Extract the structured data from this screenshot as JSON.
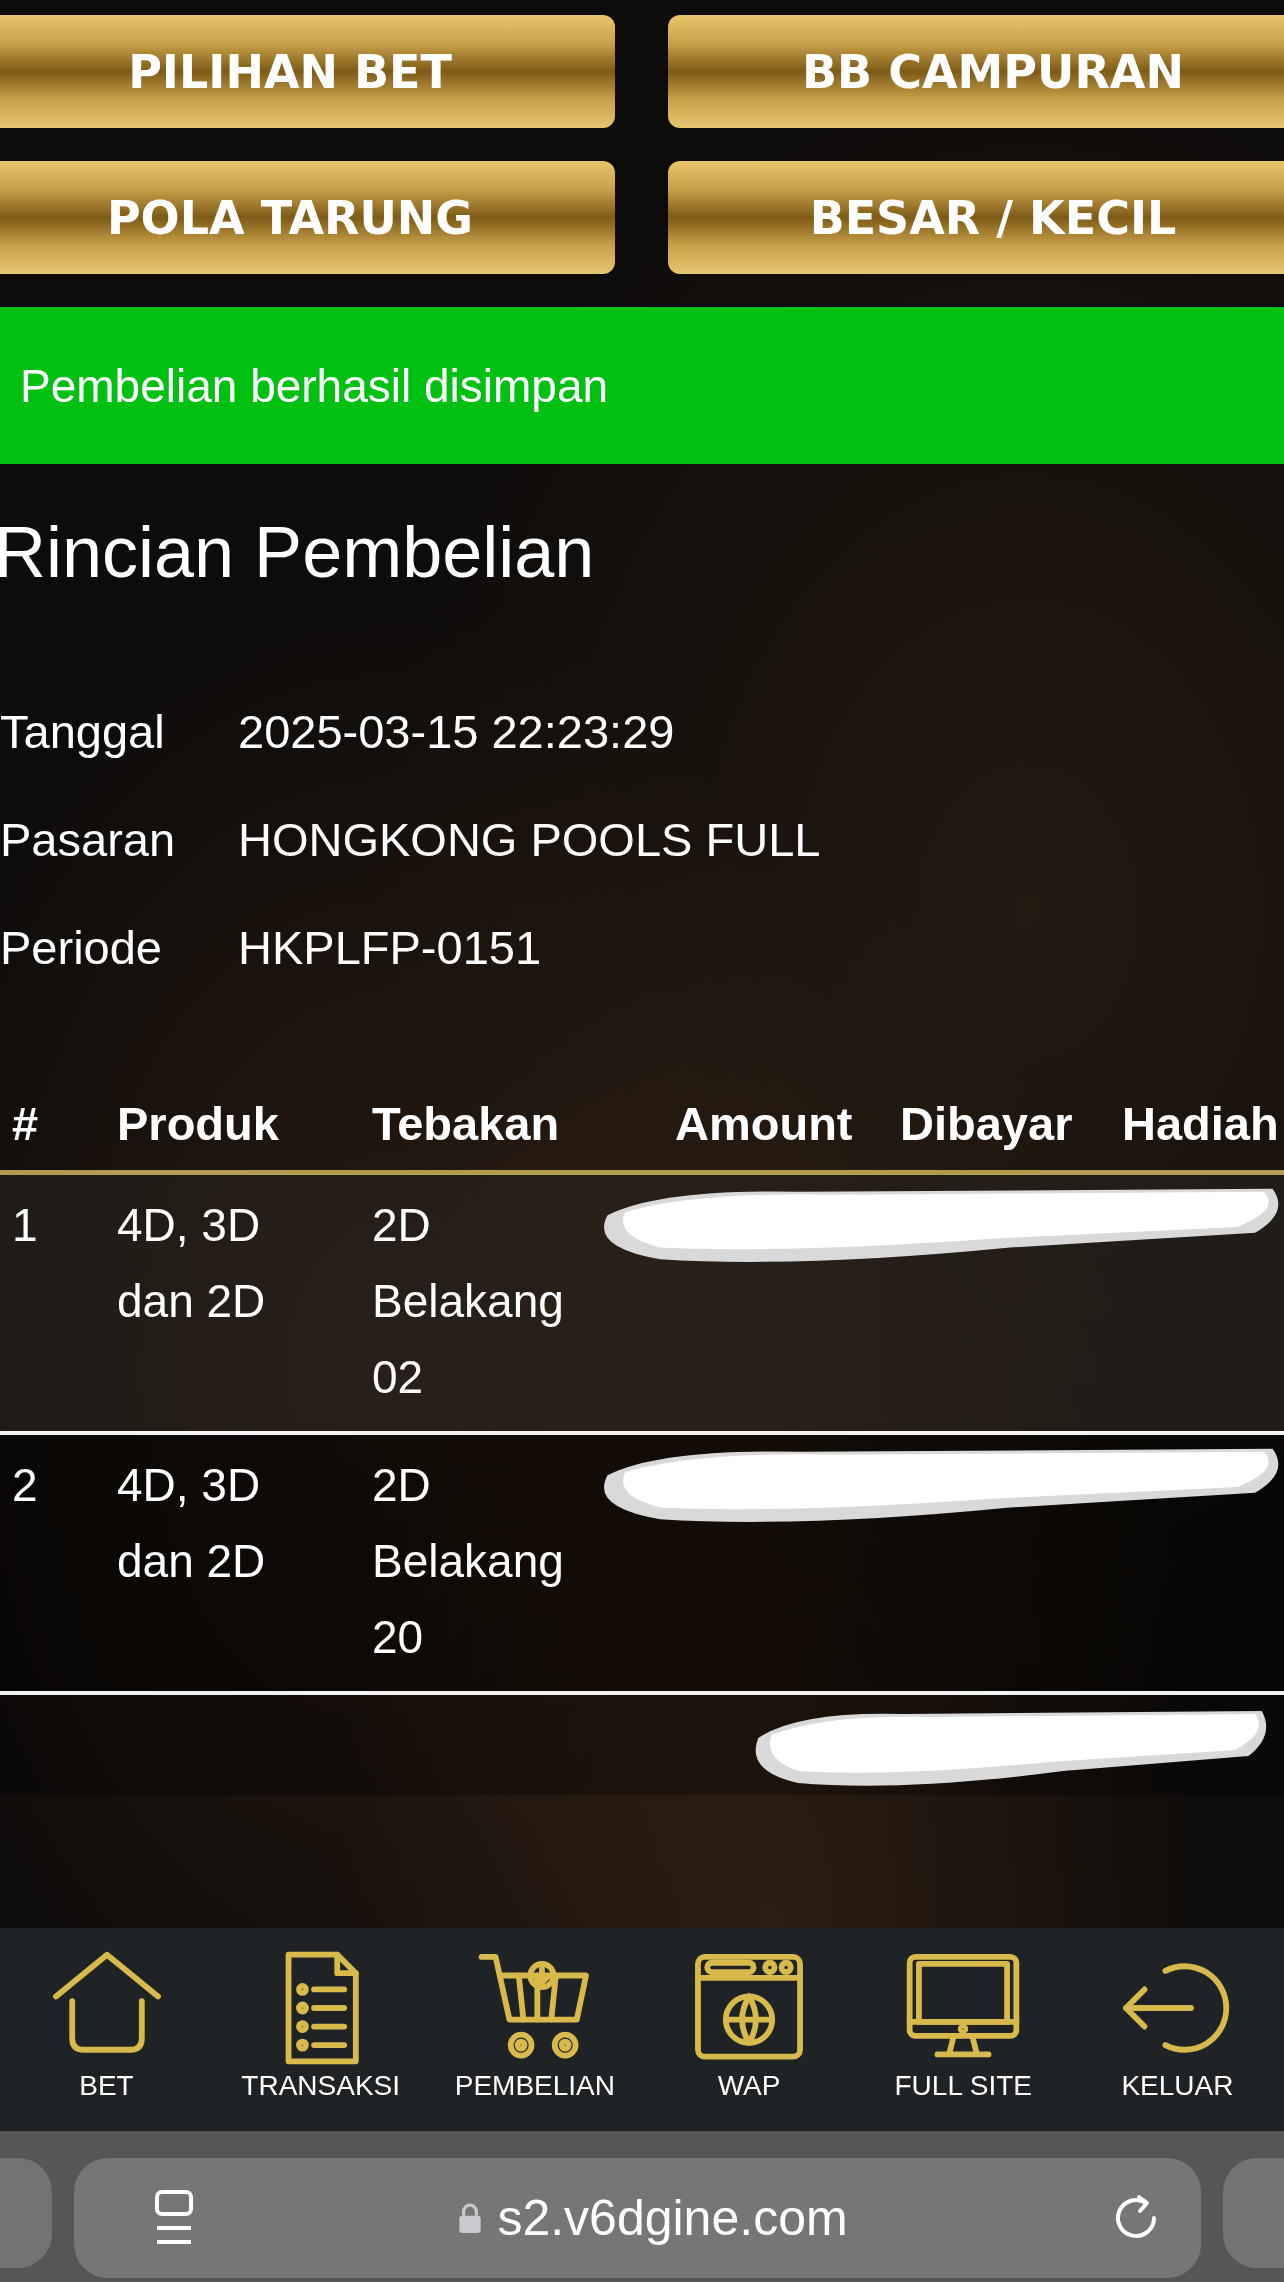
{
  "menu_buttons": [
    "PILIHAN BET",
    "BB CAMPURAN",
    "POLA TARUNG",
    "BESAR / KECIL"
  ],
  "alert": {
    "text": "Pembelian berhasil disimpan"
  },
  "title": "Rincian Pembelian",
  "details": [
    {
      "label": "Tanggal",
      "value": "2025-03-15 22:23:29"
    },
    {
      "label": "Pasaran",
      "value": "HONGKONG POOLS FULL"
    },
    {
      "label": "Periode",
      "value": "HKPLFP-0151"
    }
  ],
  "table": {
    "columns": [
      "#",
      "Produk",
      "Tebakan",
      "Amount",
      "Dibayar",
      "Hadiah"
    ],
    "rows": [
      {
        "no": "1",
        "product": [
          "4D, 3D",
          "dan 2D"
        ],
        "guess": [
          "2D",
          "Belakang",
          "02"
        ],
        "redacted": true
      },
      {
        "no": "2",
        "product": [
          "4D, 3D",
          "dan 2D"
        ],
        "guess": [
          "2D",
          "Belakang",
          "20"
        ],
        "redacted": true
      }
    ],
    "total": {
      "redacted": true
    }
  },
  "bottom_nav": [
    {
      "label": "BET"
    },
    {
      "label": "TRANSAKSI"
    },
    {
      "label": "PEMBELIAN"
    },
    {
      "label": "WAP"
    },
    {
      "label": "FULL SITE"
    },
    {
      "label": "KELUAR"
    }
  ],
  "browser": {
    "url": "s2.v6dgine.com"
  }
}
